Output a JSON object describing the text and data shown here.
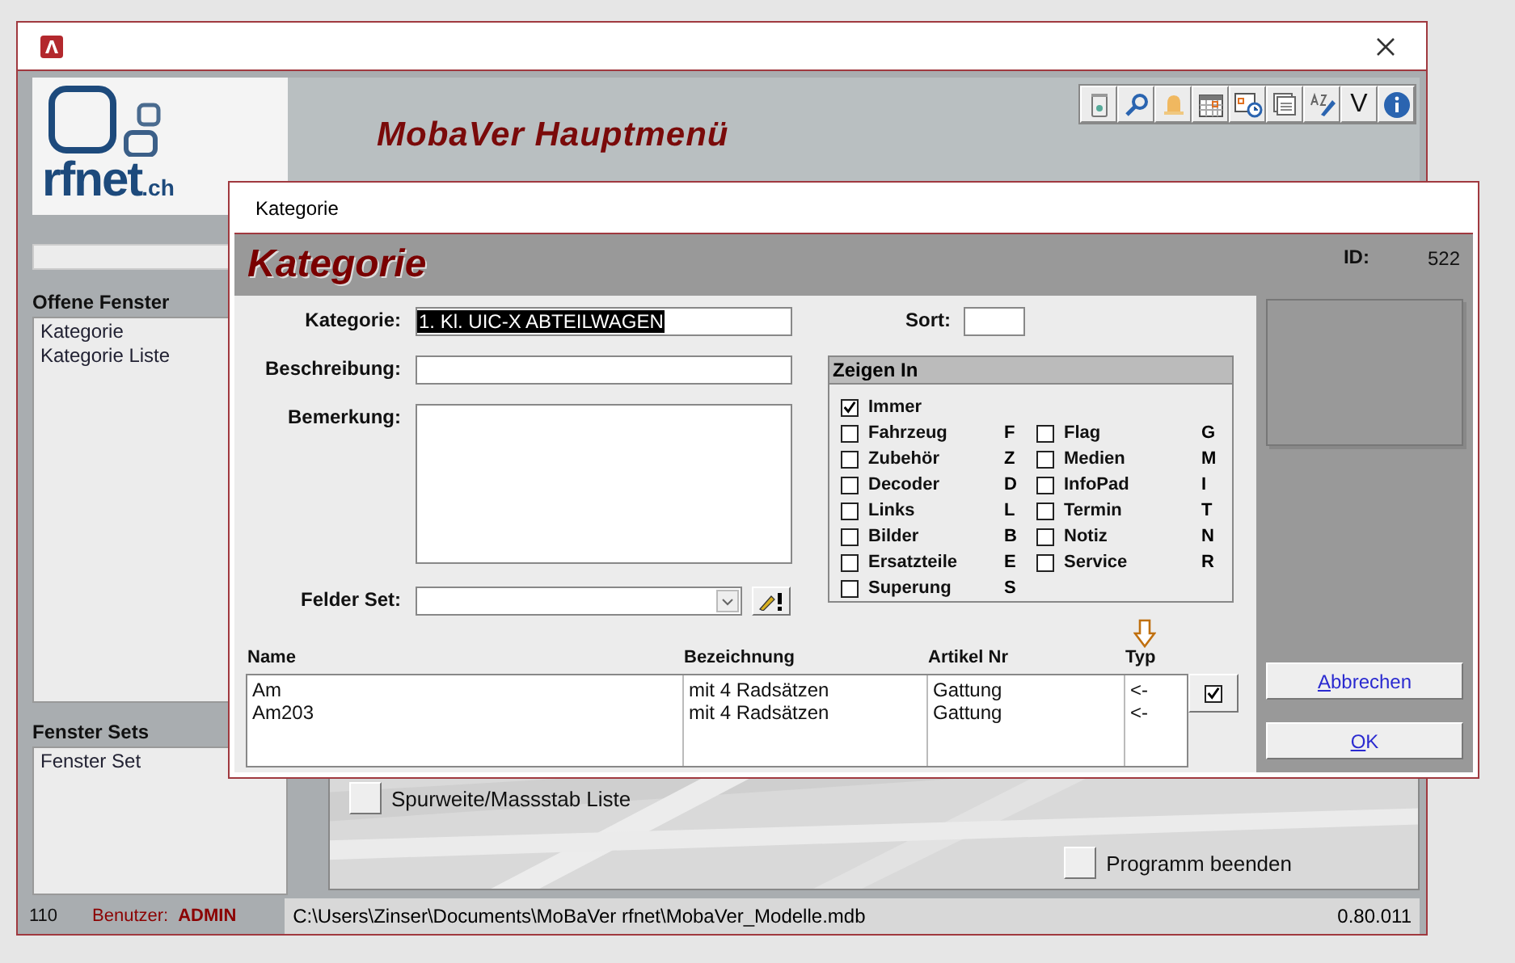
{
  "main_window": {
    "logo": {
      "text": "rfnet",
      "suffix": ".ch"
    },
    "title": "MobaVer Hauptmenü",
    "toolbar_letter": "V"
  },
  "sidebar": {
    "open_windows": {
      "title": "Offene Fenster",
      "items": [
        "Kategorie",
        "Kategorie Liste"
      ]
    },
    "window_sets": {
      "title": "Fenster Sets",
      "items": [
        "Fenster Set"
      ]
    }
  },
  "menu_buttons": [
    {
      "label": "Spurweite/Massstab Liste"
    },
    {
      "label": "Programm beenden"
    }
  ],
  "status_bar": {
    "count": "110",
    "user_label": "Benutzer:",
    "user": "ADMIN",
    "path": "C:\\Users\\Zinser\\Documents\\MoBaVer rfnet\\MobaVer_Modelle.mdb",
    "version": "0.80.011"
  },
  "dialog": {
    "title": "Kategorie",
    "header": "Kategorie",
    "id_label": "ID:",
    "id": "522",
    "fields": [
      {
        "label": "Kategorie:",
        "value": "1. Kl. UIC-X ABTEILWAGEN",
        "kind": "selected-text"
      },
      {
        "label": "Beschreibung:",
        "kind": "text"
      },
      {
        "label": "Bemerkung:",
        "kind": "memo"
      },
      {
        "label": "Felder Set:",
        "kind": "combo"
      }
    ],
    "sort_label": "Sort:",
    "zeigen_in": {
      "title": "Zeigen In",
      "columns": [
        [
          {
            "label": "Immer",
            "checked": true
          },
          {
            "label": "Fahrzeug",
            "letter": "F",
            "checked": false
          },
          {
            "label": "Zubehör",
            "letter": "Z",
            "checked": false
          },
          {
            "label": "Decoder",
            "letter": "D",
            "checked": false
          },
          {
            "label": "Links",
            "letter": "L",
            "checked": false
          },
          {
            "label": "Bilder",
            "letter": "B",
            "checked": false
          },
          {
            "label": "Ersatzteile",
            "letter": "E",
            "checked": false
          },
          {
            "label": "Superung",
            "letter": "S",
            "checked": false
          }
        ],
        [
          {
            "label": "Flag",
            "letter": "G",
            "checked": false
          },
          {
            "label": "Medien",
            "letter": "M",
            "checked": false
          },
          {
            "label": "InfoPad",
            "letter": "I",
            "checked": false
          },
          {
            "label": "Termin",
            "letter": "T",
            "checked": false
          },
          {
            "label": "Notiz",
            "letter": "N",
            "checked": false
          },
          {
            "label": "Service",
            "letter": "R",
            "checked": false
          }
        ]
      ]
    },
    "table": {
      "columns": [
        "Name",
        "Bezeichnung",
        "Artikel Nr",
        "Typ"
      ],
      "rows": [
        [
          "Am",
          "mit 4 Radsätzen",
          "Gattung",
          "<-"
        ],
        [
          "Am203",
          "mit 4 Radsätzen",
          "Gattung",
          "<-"
        ]
      ]
    },
    "typ_filter_checked": true,
    "buttons": [
      {
        "label": "Abbrechen"
      },
      {
        "label": "OK"
      }
    ]
  }
}
